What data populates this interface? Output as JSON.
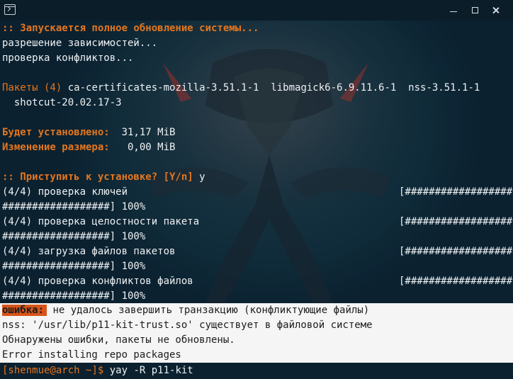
{
  "window": {
    "colors": {
      "accent": "#e5761e",
      "error_bg": "#d6541a",
      "titlebar": "#0b1d29"
    }
  },
  "terminal": {
    "start_line": ":: Запускается полное обновление системы...",
    "resolve_line": "разрешение зависимостей...",
    "conflicts_line": "проверка конфликтов...",
    "packages_label": "Пакеты (4)",
    "packages_line1": " ca-certificates-mozilla-3.51.1-1  libmagick6-6.9.11.6-1  nss-3.51.1-1",
    "packages_line2": "  shotcut-20.02.17-3",
    "install_label": "Будет установлено:",
    "install_value": "  31,17 MiB",
    "resize_label": "Изменение размера:",
    "resize_value": "   0,00 MiB",
    "confirm_prompt": ":: Приступить к установке? [Y/n]",
    "confirm_answer": " y",
    "progress": [
      {
        "label": "(4/4) проверка ключей",
        "bar_start": "[##################",
        "bar_end": "##################] 100%"
      },
      {
        "label": "(4/4) проверка целостности пакета",
        "bar_start": "[##################",
        "bar_end": "##################] 100%"
      },
      {
        "label": "(4/4) загрузка файлов пакетов",
        "bar_start": "[##################",
        "bar_end": "##################] 100%"
      },
      {
        "label": "(4/4) проверка конфликтов файлов",
        "bar_start": "[##################",
        "bar_end": "##################] 100%"
      }
    ],
    "error_tag": "ошибка:",
    "error_msg": " не удалось завершить транзакцию (конфликтующие файлы)",
    "error_nss": "nss: '/usr/lib/p11-kit-trust.so' существует в файловой системе",
    "error_found": "Обнаружены ошибки, пакеты не обновлены.",
    "error_repo": "Error installing repo packages",
    "prompt": "[shenmue@arch ~]$",
    "command": " yay -R p11-kit"
  }
}
